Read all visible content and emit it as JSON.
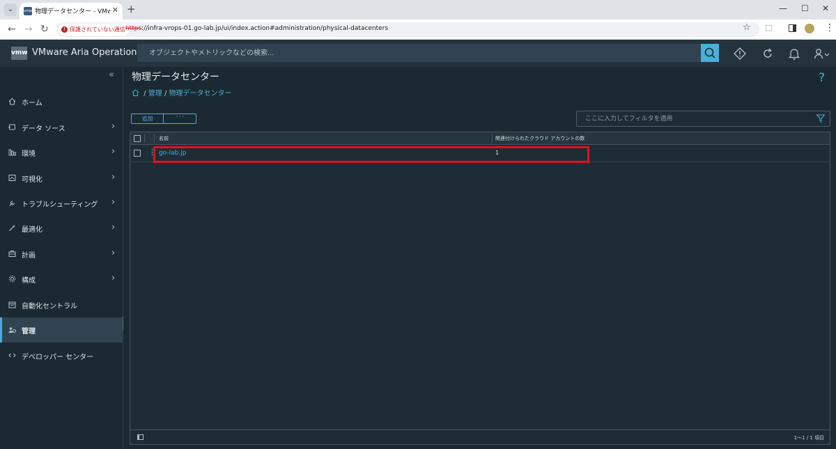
{
  "browser": {
    "tab_title": "物理データセンター - VMware Aria",
    "tab_close": "✕",
    "new_tab": "+",
    "security_label": "保護されていない通信",
    "url_scheme": "https",
    "url_rest": "://infra-vrops-01.go-lab.jp/ui/index.action#administration/physical-datacenters",
    "window": {
      "minimize": "—",
      "maximize": "☐",
      "close": "✕"
    }
  },
  "app": {
    "logo": "vmw",
    "title": "VMware Aria Operations",
    "search_placeholder": "オブジェクトやメトリックなどの検索..."
  },
  "sidebar": {
    "items": [
      {
        "label": "ホーム",
        "icon": "home-icon",
        "chevron": false
      },
      {
        "label": "データ ソース",
        "icon": "data-source-icon",
        "chevron": true
      },
      {
        "label": "環境",
        "icon": "environment-icon",
        "chevron": true
      },
      {
        "label": "可視化",
        "icon": "visualize-icon",
        "chevron": true
      },
      {
        "label": "トラブルシューティング",
        "icon": "wrench-icon",
        "chevron": true
      },
      {
        "label": "最適化",
        "icon": "optimize-icon",
        "chevron": true
      },
      {
        "label": "計画",
        "icon": "plan-icon",
        "chevron": true
      },
      {
        "label": "構成",
        "icon": "gear-icon",
        "chevron": true
      },
      {
        "label": "自動化セントラル",
        "icon": "calendar-icon",
        "chevron": false
      },
      {
        "label": "管理",
        "icon": "admin-icon",
        "chevron": false,
        "active": true
      },
      {
        "label": "デベロッパー センター",
        "icon": "code-icon",
        "chevron": false
      }
    ]
  },
  "main": {
    "page_title": "物理データセンター",
    "breadcrumb": {
      "sep": "/",
      "admin": "管理",
      "current": "物理データセンター"
    },
    "toolbar": {
      "add_label": "追加",
      "more_label": "···"
    },
    "filter_placeholder": "ここに入力してフィルタを適用",
    "grid": {
      "columns": [
        "名前",
        "関連付けられたクラウド アカウントの数"
      ],
      "rows": [
        {
          "name": "go-lab.jp",
          "count": "1"
        }
      ],
      "footer": "1～1 / 1 項目"
    }
  },
  "colors": {
    "accent": "#49afd9",
    "highlight": "#e0121e",
    "bg": "#1b2a32"
  }
}
